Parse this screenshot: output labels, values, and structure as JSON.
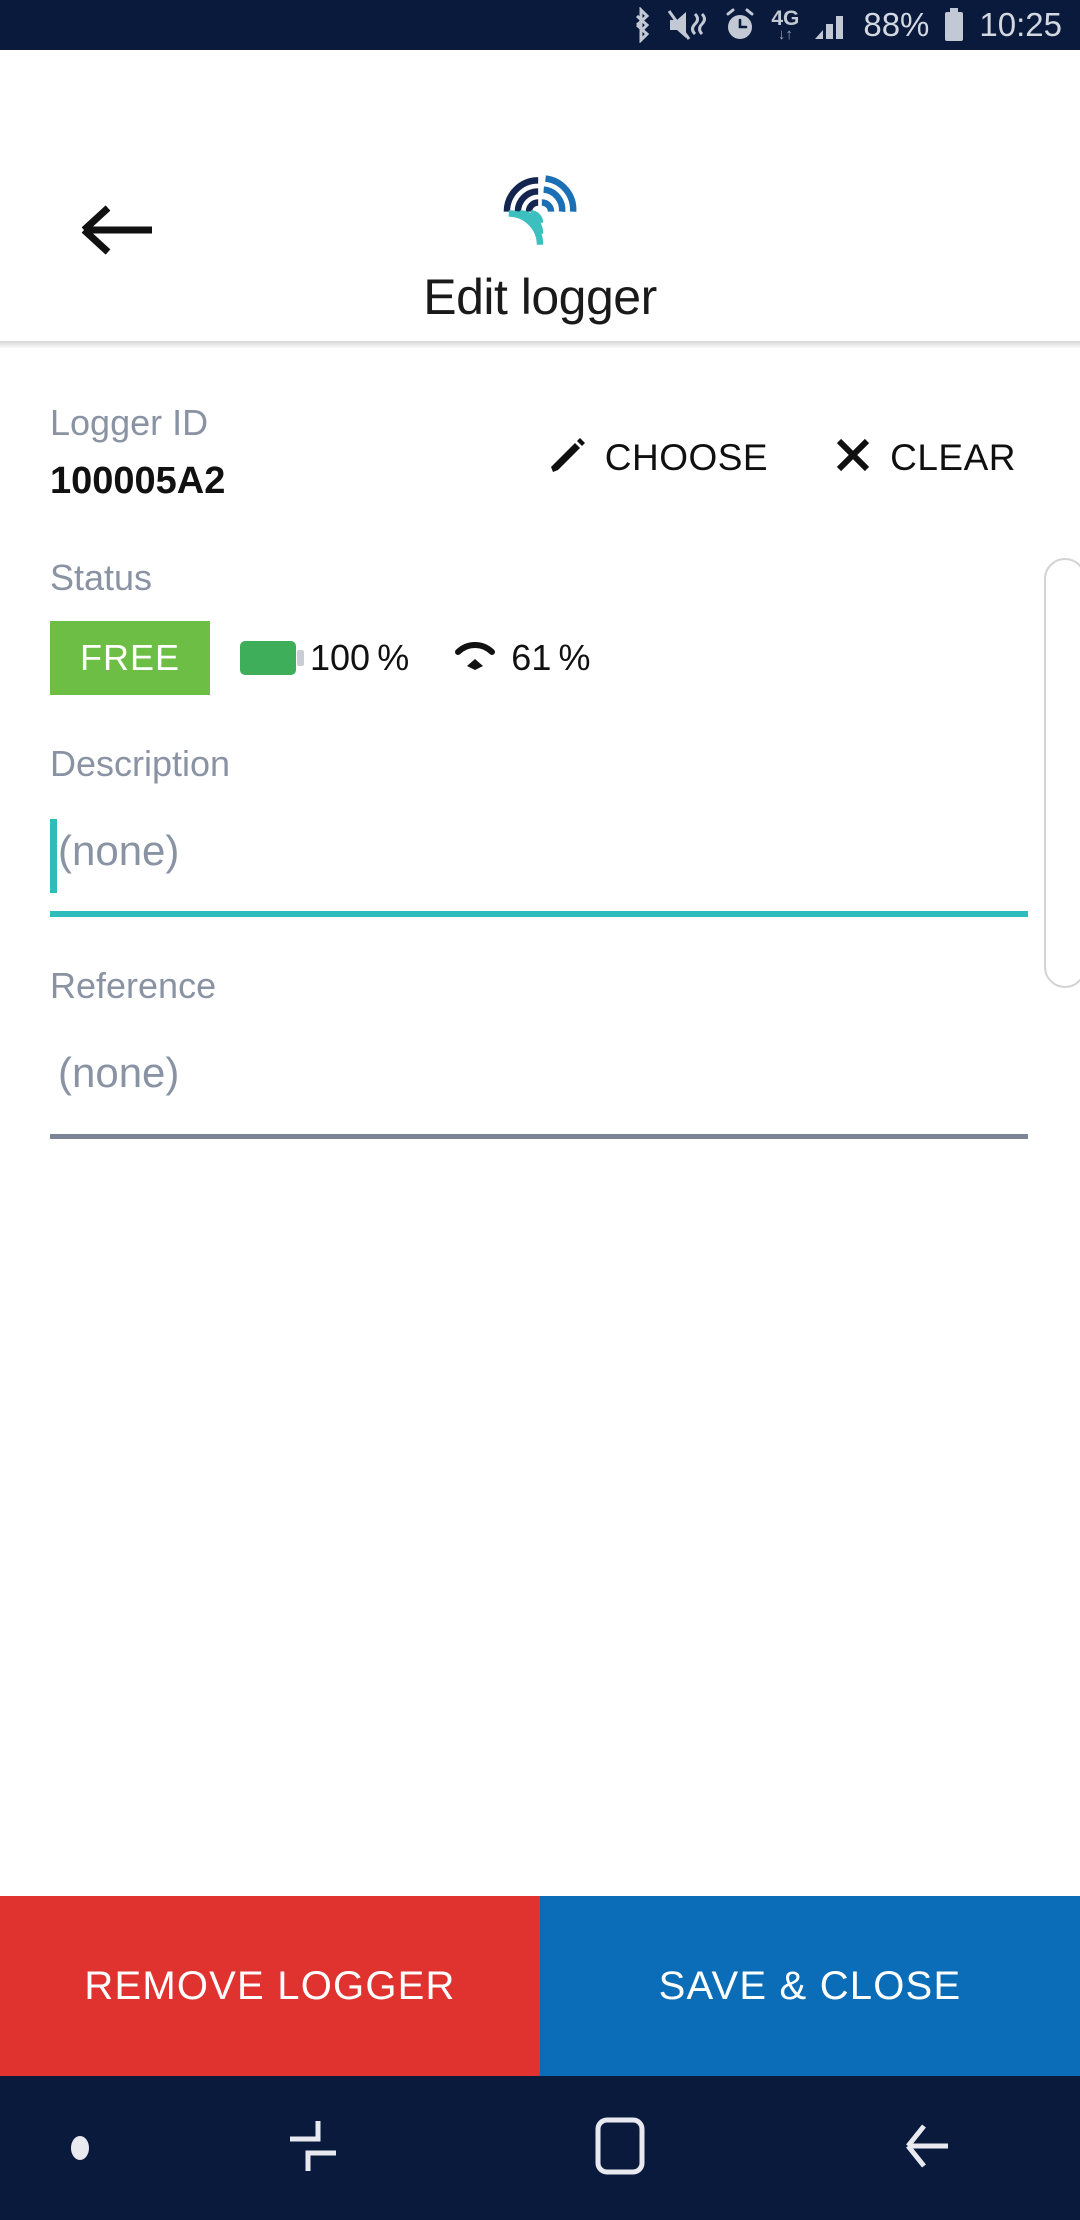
{
  "statusbar": {
    "icons": [
      "bluetooth-icon",
      "mute-vibrate-icon",
      "alarm-icon"
    ],
    "network_label": "4G",
    "network_arrows": "↓↑",
    "signal_icon": "signal-bars-icon",
    "battery_percent": "88%",
    "battery_icon": "battery-icon",
    "time": "10:25"
  },
  "appbar": {
    "back_icon": "back-arrow-icon",
    "logo": "app-logo-icon",
    "title": "Edit logger"
  },
  "form": {
    "logger": {
      "label": "Logger ID",
      "value": "100005A2",
      "choose_label": "CHOOSE",
      "choose_icon": "pencil-icon",
      "clear_label": "CLEAR",
      "clear_icon": "close-x-icon"
    },
    "status": {
      "label": "Status",
      "badge": "FREE",
      "battery_icon": "battery-level-icon",
      "battery_value": "100 %",
      "signal_icon": "wifi-signal-icon",
      "signal_value": "61 %"
    },
    "description": {
      "label": "Description",
      "value": "(none)",
      "placeholder": "(none)"
    },
    "reference": {
      "label": "Reference",
      "value": "(none)",
      "placeholder": "(none)"
    }
  },
  "actions": {
    "remove_label": "REMOVE LOGGER",
    "save_label": "SAVE & CLOSE"
  },
  "navbar": {
    "dot_icon": "notification-dot-icon",
    "recents_icon": "recents-icon",
    "home_icon": "home-icon",
    "back_icon": "nav-back-icon"
  },
  "colors": {
    "status_bar_bg": "#0A1A3C",
    "accent_teal": "#2FBCBC",
    "badge_green": "#6CBE45",
    "battery_green": "#3FAE5A",
    "remove_red": "#E0322F",
    "save_blue": "#0B6DB7",
    "label_gray": "#8A93A3"
  }
}
